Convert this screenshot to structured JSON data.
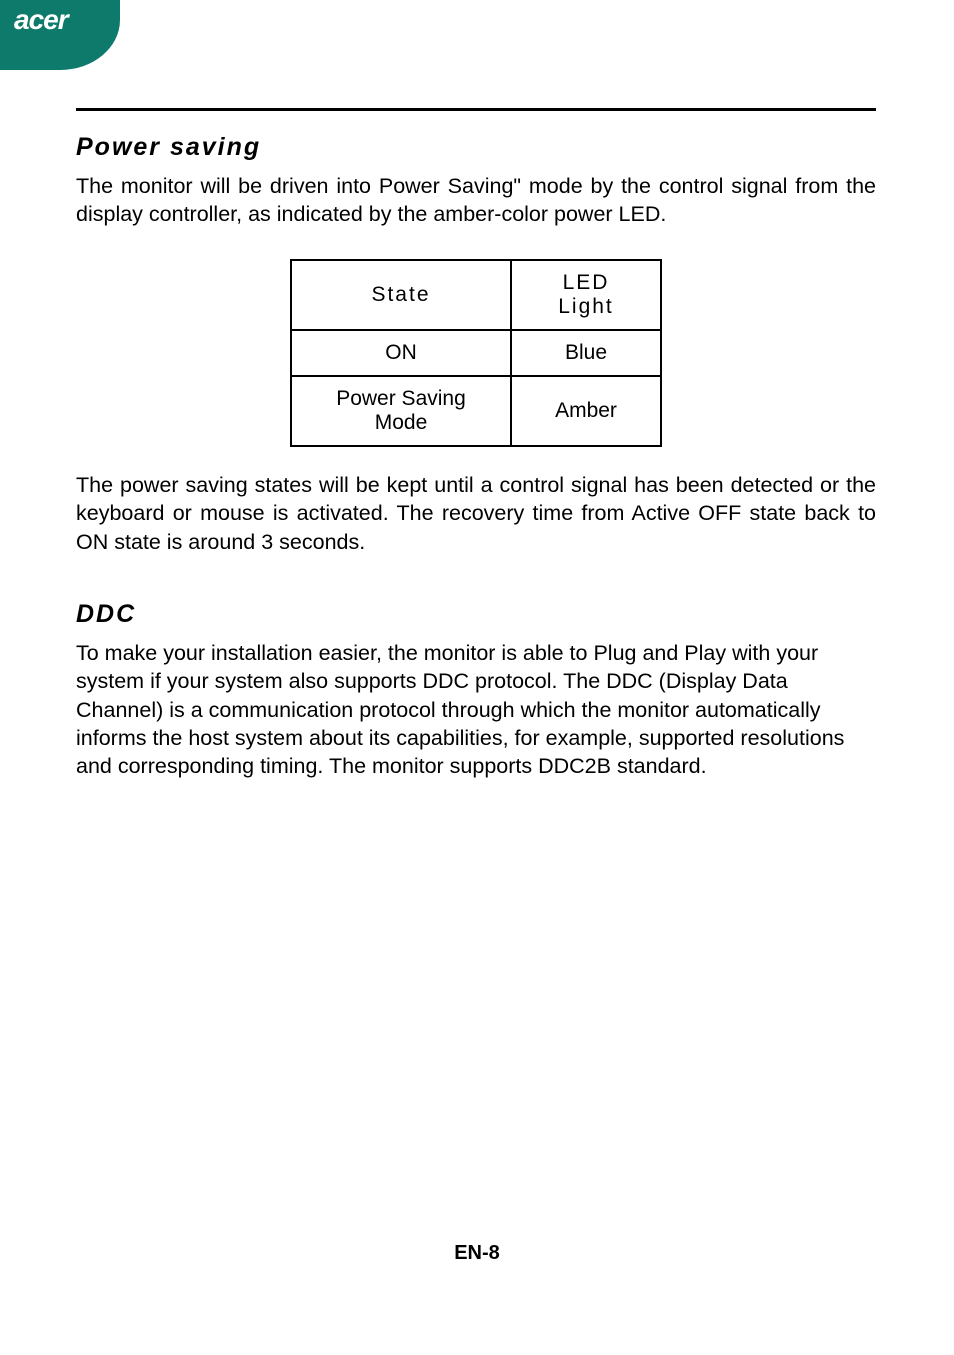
{
  "header": {
    "logo": "acer"
  },
  "sections": {
    "power_saving": {
      "heading": "Power saving",
      "para1": "The monitor will be driven into Power Saving\" mode by the control signal from the display controller, as indicated by the amber-color power LED.",
      "para2": "The power saving states will be kept until a control signal has been detected or the keyboard or mouse is activated. The recovery time from Active OFF state back to ON state is around 3 seconds."
    },
    "ddc": {
      "heading": "DDC",
      "para1": "To make your installation easier, the monitor is able to Plug and Play with your system if your system also supports DDC protocol. The DDC (Display Data Channel) is a communication protocol through which the monitor automatically informs the host system  about its capabilities, for example, supported resolutions and corresponding timing. The monitor supports DDC2B standard."
    }
  },
  "table": {
    "header": {
      "c1": "State",
      "c2": "LED Light"
    },
    "rows": [
      {
        "c1": "ON",
        "c2": "Blue"
      },
      {
        "c1": "Power Saving Mode",
        "c2": "Amber"
      }
    ]
  },
  "page_number": "EN-8"
}
